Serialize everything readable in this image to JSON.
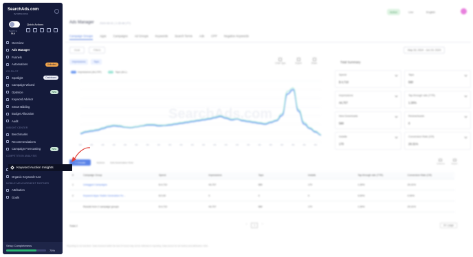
{
  "sidebar": {
    "logo": "SearchAds.com",
    "logo_sub": "by MobileAction",
    "switch_label": "Switch to",
    "switch_value": "MA",
    "quick_actions": "Quick Actions",
    "items": [
      {
        "label": "Overview"
      },
      {
        "label": "Ads Manager",
        "active": true
      },
      {
        "label": "Funnels"
      },
      {
        "label": "Automations",
        "badge": "Unlimited"
      },
      {
        "section": "CO-PILOT"
      },
      {
        "label": "Spotlight",
        "badge": "Dashboard"
      },
      {
        "label": "Campaign Wizard"
      },
      {
        "label": "Optimize",
        "badge": "New"
      },
      {
        "label": "Keyword Advisor"
      },
      {
        "label": "Smart Bidding"
      },
      {
        "label": "Budget Allocation"
      },
      {
        "label": "Audit"
      },
      {
        "section": "INSIGHT CENTER"
      },
      {
        "label": "Benchmarks"
      },
      {
        "label": "Recommendations"
      },
      {
        "label": "Campaign Forecasting",
        "badge": "New"
      },
      {
        "section": "COMPETITION ANALYSIS"
      },
      {
        "label": ""
      },
      {
        "label": "CPP Intelligence"
      },
      {
        "label": "Organic Keyword Hunt"
      },
      {
        "section": "MOBILE MEASUREMENT PARTNER"
      },
      {
        "label": "Attribution"
      },
      {
        "label": "Goals"
      }
    ],
    "highlight_item": "Keyword Auction Insights",
    "setup_label": "Setup Completeness",
    "setup_pct": "75%",
    "setup_value": 0.75
  },
  "main": {
    "title": "Ads Manager",
    "title_meta": "2024.06.01 | 1:35 All (TT)",
    "top_pills": [
      "Active",
      "Live",
      "English"
    ],
    "tabs": [
      "Campaign Groups",
      "Apps",
      "Campaigns",
      "Ad Groups",
      "Keywords",
      "Search Terms",
      "Ads",
      "CPP",
      "Negative Keywords"
    ],
    "filters": [
      "Goal",
      "Filters"
    ],
    "date_range": "May 26, 2024   -   Jun 24, 2024",
    "chips": [
      "Impressions",
      "Taps"
    ],
    "tools": [
      "Chart Type",
      "Export",
      "Share"
    ],
    "legend": [
      {
        "name": "Impressions (ALLTIP)",
        "color": "#5b8def"
      },
      {
        "name": "Taps (ALL)",
        "color": "#8fe0d0"
      }
    ],
    "summary_title": "Total Summary",
    "kpis": [
      {
        "label": "Spend",
        "value": "$ 4,710"
      },
      {
        "label": "Taps",
        "value": "580"
      },
      {
        "label": "Impressions",
        "value": "44,707"
      },
      {
        "label": "Tap-through rate (TTR)",
        "value": "1.30%"
      },
      {
        "label": "New Downloads",
        "value": "580"
      },
      {
        "label": "Redownloads",
        "value": "0"
      },
      {
        "label": "Installs",
        "value": "170"
      },
      {
        "label": "Conversion Rate (CR)",
        "value": "29.31%"
      }
    ],
    "table_bar": {
      "create": "+ Create",
      "actions": "Actions",
      "add_auto": "Add Automation Rule"
    },
    "table_icons": [
      "Columns",
      "Export"
    ],
    "columns": [
      "#",
      "Campaign Group",
      "Spend",
      "Impressions",
      "Taps",
      "Installs",
      "Tap-through rate (TTR)",
      "Conversion Rate (CR)"
    ],
    "rows": [
      [
        "1",
        "Untagged Campaigns",
        "$ 4,710",
        "44,707",
        "580",
        "170",
        "1.30%",
        "29.31%"
      ],
      [
        "2",
        "Keyword Apps Testim Generation Fe...",
        "$ 0.00",
        "0",
        "0",
        "0",
        "0.00%",
        "0.00%"
      ],
      [
        "",
        "Results from 2 campaign groups",
        "$ 4,710",
        "44,707",
        "580",
        "170",
        "1.30%",
        "29.31%"
      ]
    ],
    "total_label": "Total 2",
    "page": "1",
    "per_page": "20 / page",
    "footnote": "Reporting is not real-time. Data received within the last 24 hours may not be reflected in reporting. Data source for all metrics and attribution: ASA."
  },
  "chart_data": {
    "type": "line",
    "ylim": [
      0,
      140
    ],
    "y2lim": [
      0,
      180
    ],
    "series": [
      {
        "name": "Impressions (ALLTIP)",
        "color": "#5b8def",
        "values": [
          18,
          22,
          24,
          26,
          30,
          34,
          36,
          35,
          33,
          32,
          34,
          36,
          38,
          38,
          36,
          37,
          38,
          40,
          42,
          44,
          46,
          48,
          50,
          52,
          55,
          58,
          54,
          50,
          52,
          48,
          46,
          44,
          42,
          40,
          44,
          48,
          60,
          110,
          120,
          70,
          40,
          30,
          22,
          15
        ]
      },
      {
        "name": "Taps (ALL)",
        "color": "#8fe0d0",
        "values": [
          20,
          24,
          26,
          28,
          32,
          36,
          38,
          37,
          34,
          33,
          35,
          37,
          40,
          40,
          38,
          38,
          40,
          42,
          44,
          46,
          48,
          50,
          52,
          54,
          57,
          60,
          56,
          52,
          53,
          50,
          48,
          46,
          44,
          42,
          46,
          50,
          64,
          116,
          124,
          74,
          44,
          32,
          24,
          16
        ]
      }
    ]
  }
}
